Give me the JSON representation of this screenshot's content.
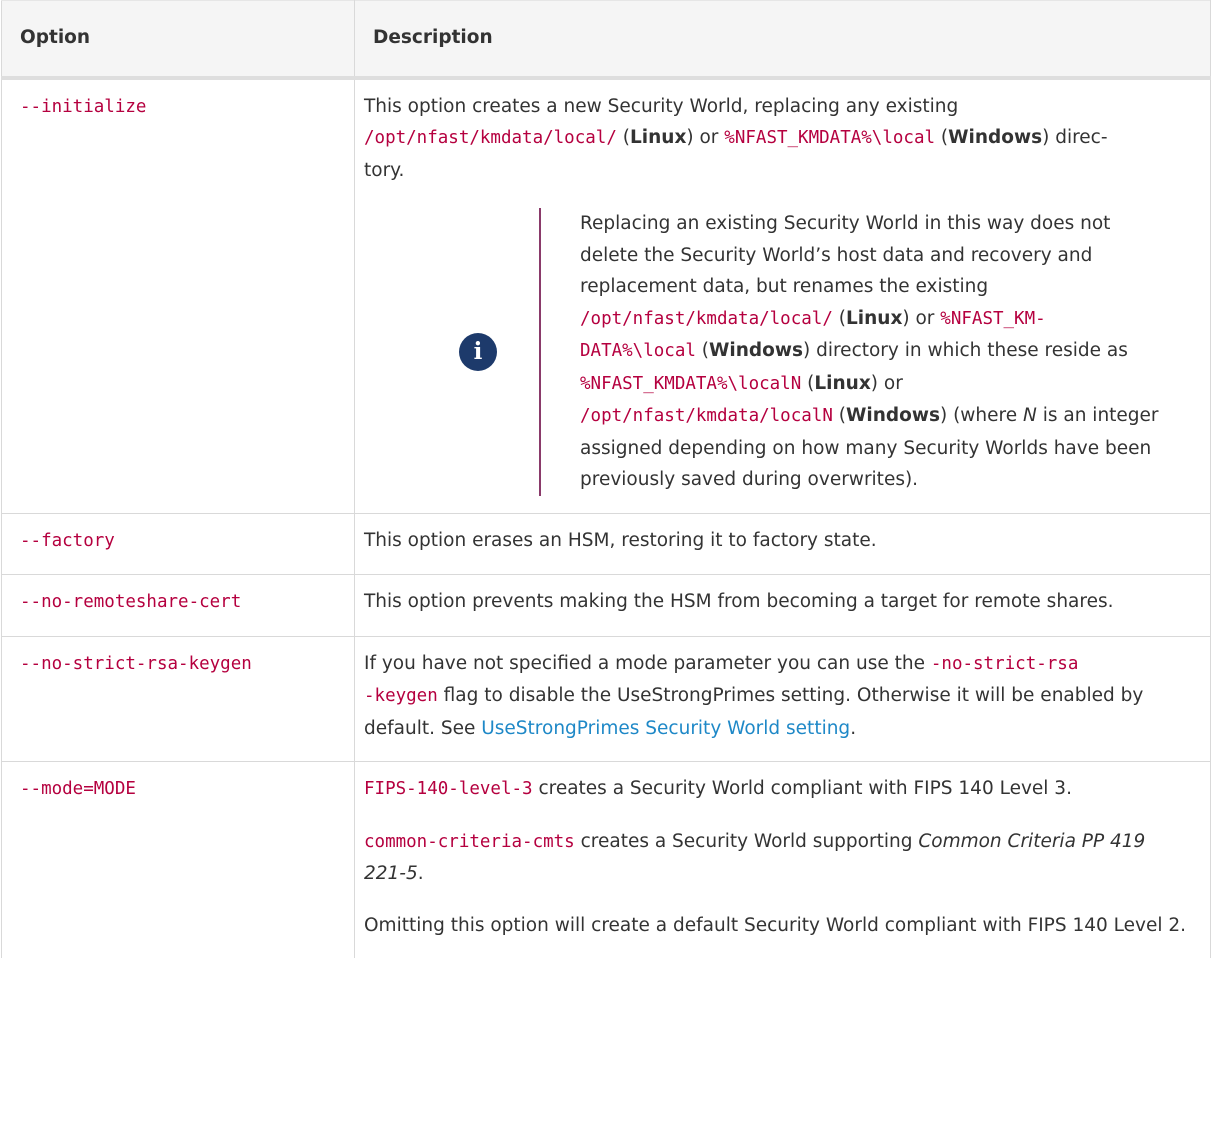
{
  "header": {
    "option": "Option",
    "description": "Description"
  },
  "rows": {
    "initialize": {
      "option": "--initialize",
      "p1_a": "This option creates a new Security World, replacing any existing ",
      "p1_code1": "/opt/nfast/kmdata/local/",
      "p1_b": " (",
      "p1_linux": "Linux",
      "p1_c": ") or ",
      "p1_code2": "%NFAST_KMDATA%\\local",
      "p1_d": " (",
      "p1_windows": "Windows",
      "p1_e": ") direc-",
      "p1_f": "tory.",
      "note": {
        "icon": "info-icon",
        "t1": "Replacing an existing Security World in this way does not delete the Security World’s host data and recovery and replacement data, but renames the existing ",
        "code1": "/opt/nfast/kmdata/local/",
        "t2": " (",
        "linux1": "Linux",
        "t3": ") or ",
        "code2a": "%NFAST_KM-",
        "code2b": "DATA%\\local",
        "t4": " (",
        "windows1": "Windows",
        "t5": ") directory in which these reside as ",
        "code3": "%NFAST_KMDATA%\\localN",
        "t6": " (",
        "linux2": "Linux",
        "t7": ") or ",
        "code4": "/opt/nfast/kmdata/localN",
        "t8": " (",
        "windows2": "Windows",
        "t9": ") (where ",
        "n": "N",
        "t10": " is an integer assigned depending on how many Security Worlds have been previously saved during overwrites)."
      }
    },
    "factory": {
      "option": "--factory",
      "desc": "This option erases an HSM, restoring it to factory state."
    },
    "no_remoteshare": {
      "option": "--no-remoteshare-cert",
      "desc": "This option prevents making the HSM from becoming a target for remote shares."
    },
    "no_strict": {
      "option": "--no-strict-rsa-keygen",
      "t1": "If you have not specified a mode parameter you can use the ",
      "code1a": "-no-strict-rsa",
      "code1b": "-keygen",
      "t2": " flag to disable the UseStrongPrimes setting. Otherwise it will be enabled by default. See ",
      "link": "UseStrongPrimes Security World setting",
      "t3": "."
    },
    "mode": {
      "option": "--mode=MODE",
      "p1_code": "FIPS-140-level-3",
      "p1_text": " creates a Security World compliant with FIPS 140 Level 3.",
      "p2_code": "common-criteria-cmts",
      "p2_text": " creates a Security World supporting ",
      "p2_italic": "Common Criteria PP 419 221-5",
      "p2_end": ".",
      "p3": "Omitting this option will create a default Security World compliant with FIPS 140 Level 2."
    }
  },
  "colors": {
    "code": "#b5003f",
    "link": "#1e88c7",
    "header_bg": "#f5f5f5",
    "icon_bg": "#1d3a6b",
    "note_bar": "#8a3a6a"
  }
}
